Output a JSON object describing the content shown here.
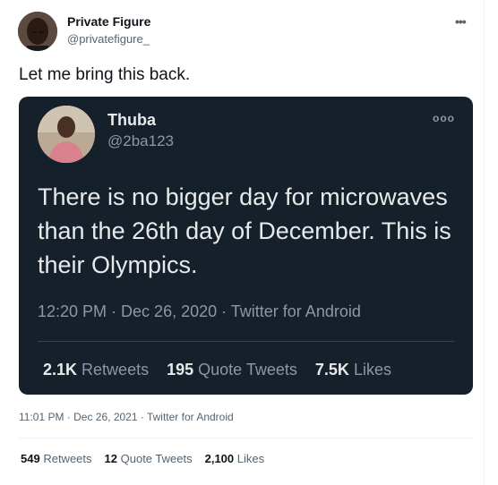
{
  "tweet": {
    "author_name": "Private Figure",
    "author_handle": "@privatefigure_",
    "more_icon": "more-horizontal-icon",
    "text": "Let me bring this back.",
    "timestamp": "11:01 PM · Dec 26, 2021 · Twitter for Android",
    "stats": {
      "retweets_count": "549",
      "retweets_label": "Retweets",
      "quotes_count": "12",
      "quotes_label": "Quote Tweets",
      "likes_count": "2,100",
      "likes_label": "Likes"
    }
  },
  "quoted": {
    "author_name": "Thuba",
    "author_handle": "@2ba123",
    "more_icon": "more-circle-icon",
    "text": "There is no bigger day for microwaves than the 26th day of December. This is their Olympics.",
    "timestamp": "12:20 PM · Dec 26, 2020 · Twitter for Android",
    "stats": {
      "retweets_count": "2.1K",
      "retweets_label": "Retweets",
      "quotes_count": "195",
      "quotes_label": "Quote Tweets",
      "likes_count": "7.5K",
      "likes_label": "Likes"
    }
  },
  "colors": {
    "card_background": "#15202b",
    "card_text": "#e7e9ea",
    "card_secondary": "#8b98a5",
    "secondary_text": "#536471"
  }
}
